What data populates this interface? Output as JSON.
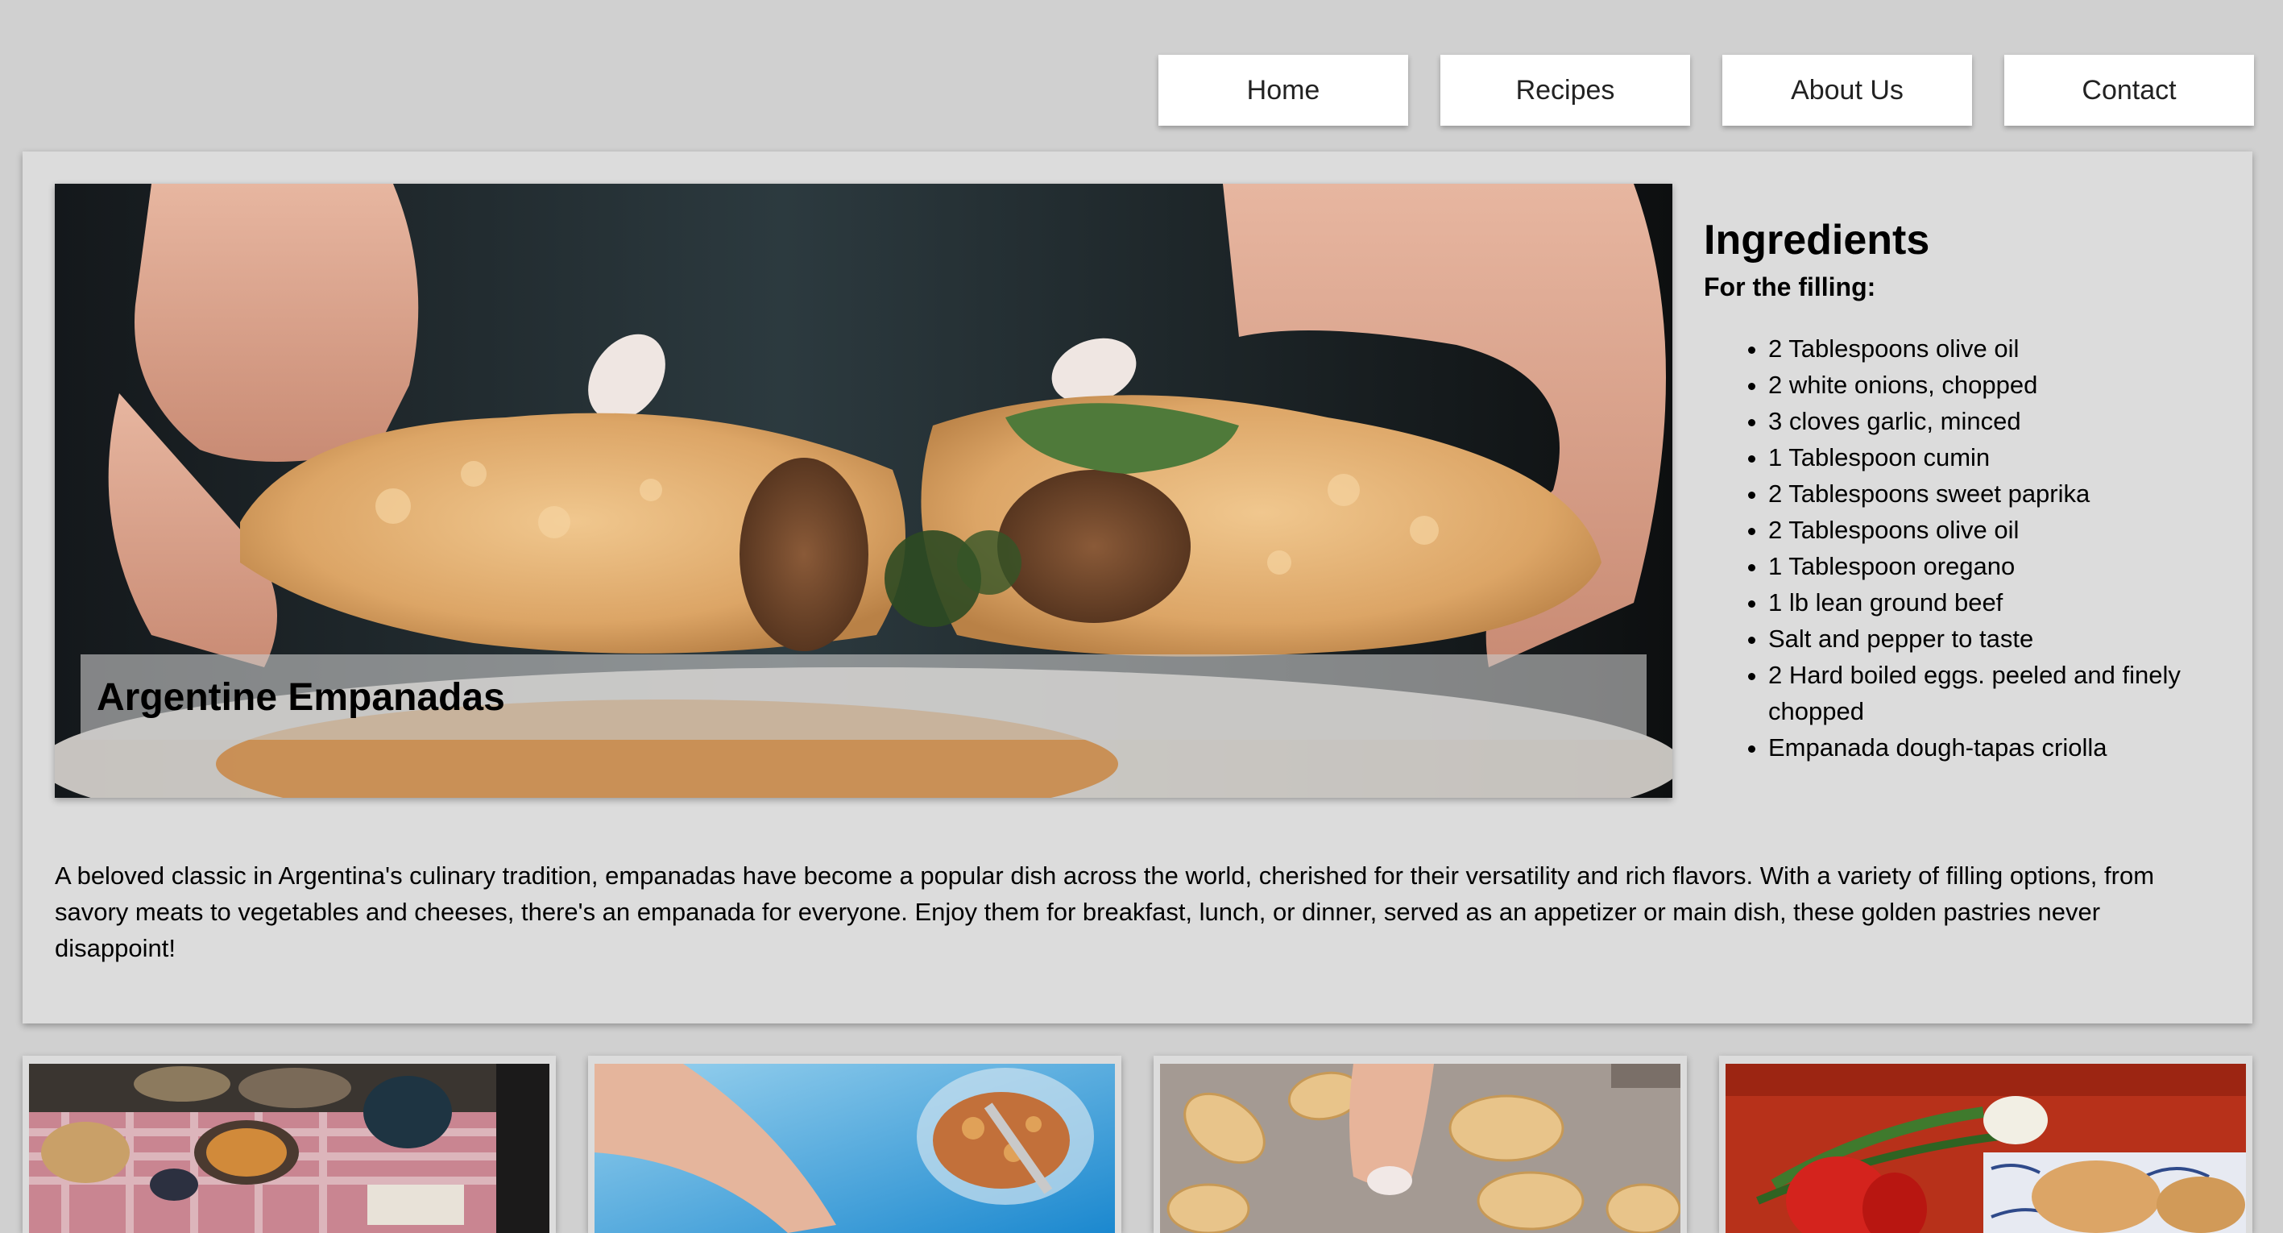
{
  "nav": {
    "items": [
      {
        "label": "Home"
      },
      {
        "label": "Recipes"
      },
      {
        "label": "About Us"
      },
      {
        "label": "Contact"
      }
    ]
  },
  "hero": {
    "title": "Argentine Empanadas"
  },
  "ingredients": {
    "heading": "Ingredients",
    "subheading": "For the filling:",
    "items": [
      "2 Tablespoons olive oil",
      "2 white onions, chopped",
      "3 cloves garlic, minced",
      "1 Tablespoon cumin",
      "2 Tablespoons sweet paprika",
      "2 Tablespoons olive oil",
      "1 Tablespoon oregano",
      "1 lb lean ground beef",
      "Salt and pepper to taste",
      "2 Hard boiled eggs. peeled and finely chopped",
      "Empanada dough-tapas criolla"
    ]
  },
  "description": "A beloved classic in Argentina's culinary tradition, empanadas have become a popular dish across the world, cherished for their versatility and rich flavors. With a variety of filling options, from savory meats to vegetables and cheeses, there's an empanada for everyone. Enjoy them for breakfast, lunch, or dinner, served as an appetizer or main dish, these golden pastries never disappoint!",
  "thumbnails": [
    {
      "name": "table-spread-photo"
    },
    {
      "name": "hand-over-bowl-photo"
    },
    {
      "name": "shaping-empanadas-photo"
    },
    {
      "name": "vegetables-and-pastries-photo"
    }
  ],
  "colors": {
    "page_background": "#d0d0d0",
    "card_background": "#dcdcdc",
    "nav_button_background": "#ffffff"
  }
}
